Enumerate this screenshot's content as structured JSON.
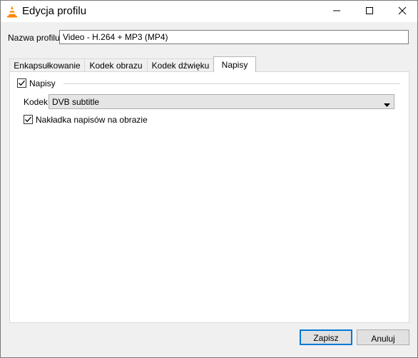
{
  "window": {
    "title": "Edycja profilu",
    "app_icon": "vlc-cone-icon",
    "controls": [
      "minimize-icon",
      "maximize-icon",
      "close-icon"
    ]
  },
  "profile": {
    "label": "Nazwa profilu",
    "value": "Video - H.264 + MP3 (MP4)"
  },
  "tabs": [
    {
      "label": "Enkapsułkowanie",
      "active": false
    },
    {
      "label": "Kodek obrazu",
      "active": false
    },
    {
      "label": "Kodek dźwięku",
      "active": false
    },
    {
      "label": "Napisy",
      "active": true
    }
  ],
  "subtitles": {
    "enable_label": "Napisy",
    "enable_checked": true,
    "codec_label": "Kodek",
    "codec_value": "DVB subtitle",
    "overlay_label": "Nakładka napisów na obrazie",
    "overlay_checked": true
  },
  "buttons": {
    "save": "Zapisz",
    "cancel": "Anuluj"
  },
  "colors": {
    "accent": "#0078d7",
    "vlc_orange": "#ff8800"
  }
}
